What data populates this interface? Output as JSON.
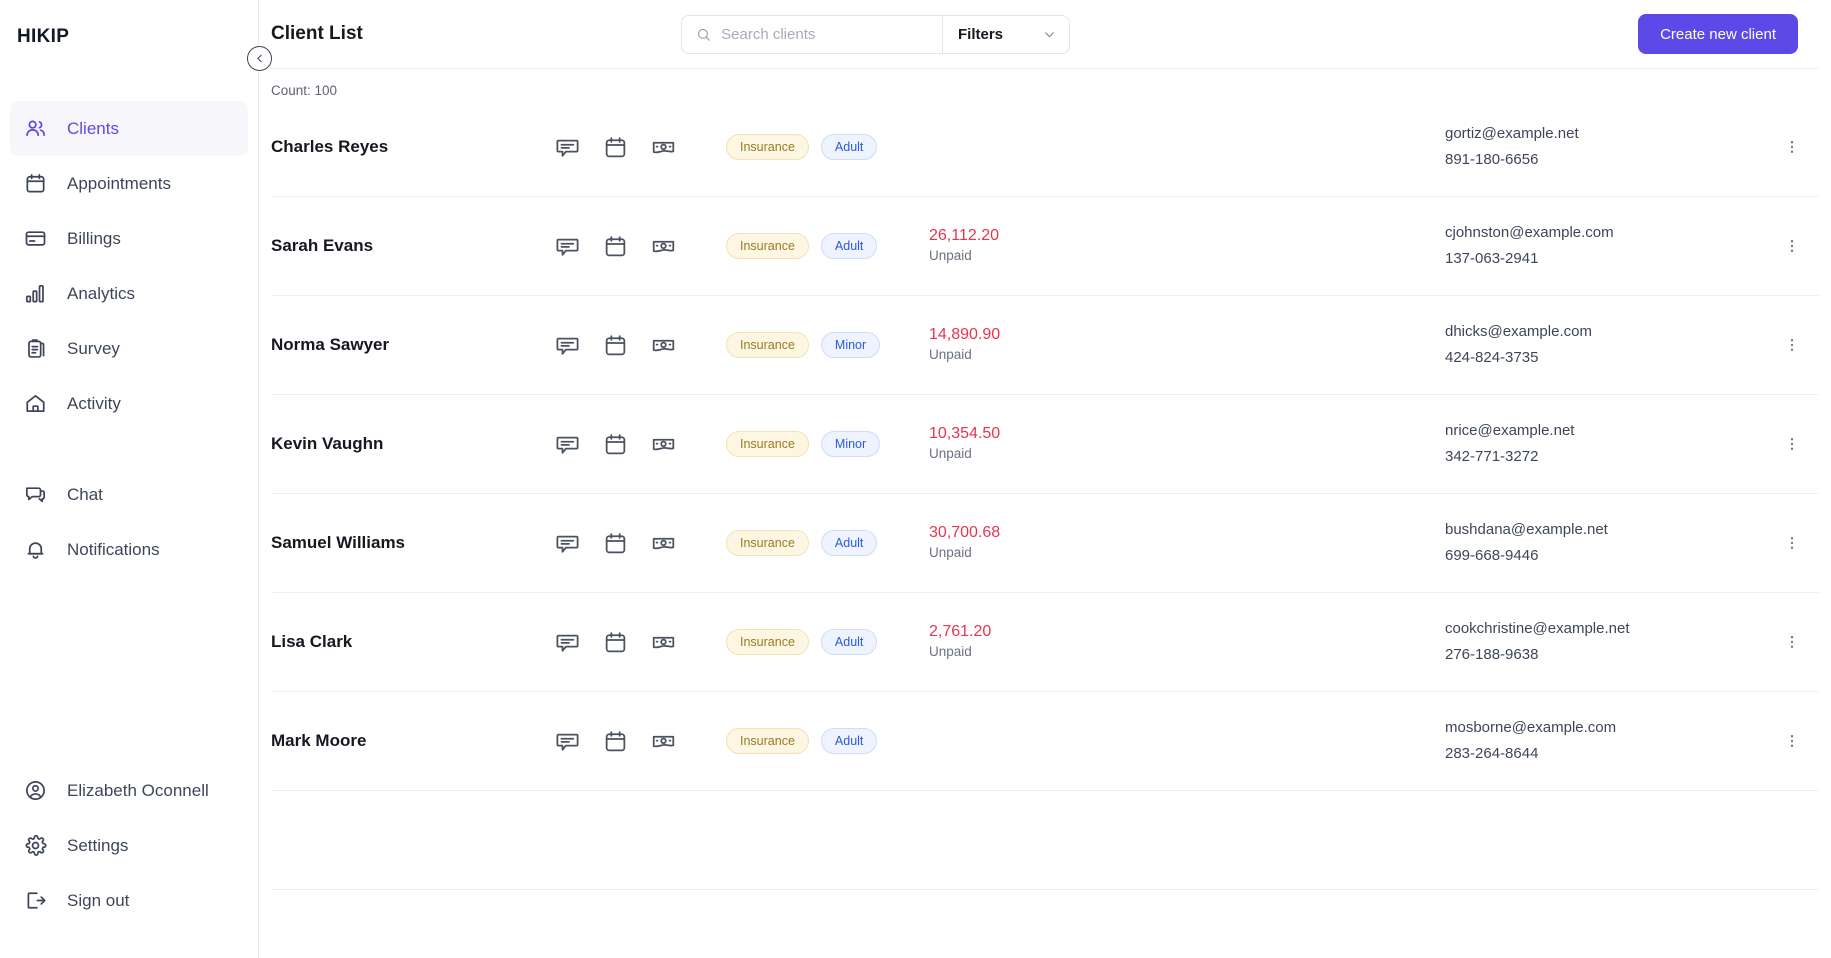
{
  "sidebar": {
    "brand": "HIKIP",
    "collapse_icon": "arrow-left-circle-icon",
    "primary_items": [
      {
        "label": "Clients",
        "icon": "users-icon",
        "active": true
      },
      {
        "label": "Appointments",
        "icon": "calendar-icon",
        "active": false
      },
      {
        "label": "Billings",
        "icon": "credit-card-icon",
        "active": false
      },
      {
        "label": "Analytics",
        "icon": "bar-chart-icon",
        "active": false
      },
      {
        "label": "Survey",
        "icon": "clipboard-icon",
        "active": false
      },
      {
        "label": "Activity",
        "icon": "home-icon",
        "active": false
      }
    ],
    "secondary_items": [
      {
        "label": "Chat",
        "icon": "chat-bubbles-icon",
        "active": false
      },
      {
        "label": "Notifications",
        "icon": "bell-icon",
        "active": false
      }
    ],
    "account_items": [
      {
        "label": "Elizabeth Oconnell",
        "icon": "user-circle-icon",
        "active": false
      },
      {
        "label": "Settings",
        "icon": "gear-icon",
        "active": false
      },
      {
        "label": "Sign out",
        "icon": "logout-icon",
        "active": false
      }
    ]
  },
  "header": {
    "title": "Client List",
    "search": {
      "placeholder": "Search clients",
      "value": "",
      "icon": "search-icon"
    },
    "filters": {
      "label": "Filters",
      "icon": "chevron-down-icon"
    },
    "create_button": "Create new client"
  },
  "list": {
    "count_label": "Count: 100",
    "row_action_icons": [
      "message-icon",
      "calendar-icon",
      "money-icon"
    ],
    "unpaid_label": "Unpaid",
    "menu_icon": "more-vertical-icon",
    "rows": [
      {
        "name": "Charles Reyes",
        "tags": [
          "Insurance",
          "Adult"
        ],
        "amount": "",
        "status": "",
        "email": "gortiz@example.net",
        "phone": "891-180-6656"
      },
      {
        "name": "Sarah Evans",
        "tags": [
          "Insurance",
          "Adult"
        ],
        "amount": "26,112.20",
        "status": "Unpaid",
        "email": "cjohnston@example.com",
        "phone": "137-063-2941"
      },
      {
        "name": "Norma Sawyer",
        "tags": [
          "Insurance",
          "Minor"
        ],
        "amount": "14,890.90",
        "status": "Unpaid",
        "email": "dhicks@example.com",
        "phone": "424-824-3735"
      },
      {
        "name": "Kevin Vaughn",
        "tags": [
          "Insurance",
          "Minor"
        ],
        "amount": "10,354.50",
        "status": "Unpaid",
        "email": "nrice@example.net",
        "phone": "342-771-3272"
      },
      {
        "name": "Samuel Williams",
        "tags": [
          "Insurance",
          "Adult"
        ],
        "amount": "30,700.68",
        "status": "Unpaid",
        "email": "bushdana@example.net",
        "phone": "699-668-9446"
      },
      {
        "name": "Lisa Clark",
        "tags": [
          "Insurance",
          "Adult"
        ],
        "amount": "2,761.20",
        "status": "Unpaid",
        "email": "cookchristine@example.net",
        "phone": "276-188-9638"
      },
      {
        "name": "Mark Moore",
        "tags": [
          "Insurance",
          "Adult"
        ],
        "amount": "",
        "status": "",
        "email": "mosborne@example.com",
        "phone": "283-264-8644"
      },
      {
        "name": "",
        "tags": [],
        "amount": "",
        "status": "",
        "email": "",
        "phone": ""
      }
    ]
  },
  "colors": {
    "accent": "#5b4ae8",
    "sidebar_active_bg": "#f6f6fb",
    "tag_insurance_bg": "#fdf6e3",
    "tag_insurance_text": "#9a7b20",
    "tag_age_bg": "#eef3fe",
    "tag_age_text": "#2a5bd7",
    "amount_unpaid": "#e8344e",
    "text_primary": "#15191f",
    "text_secondary": "#3d4659",
    "border": "#e8eaee"
  }
}
